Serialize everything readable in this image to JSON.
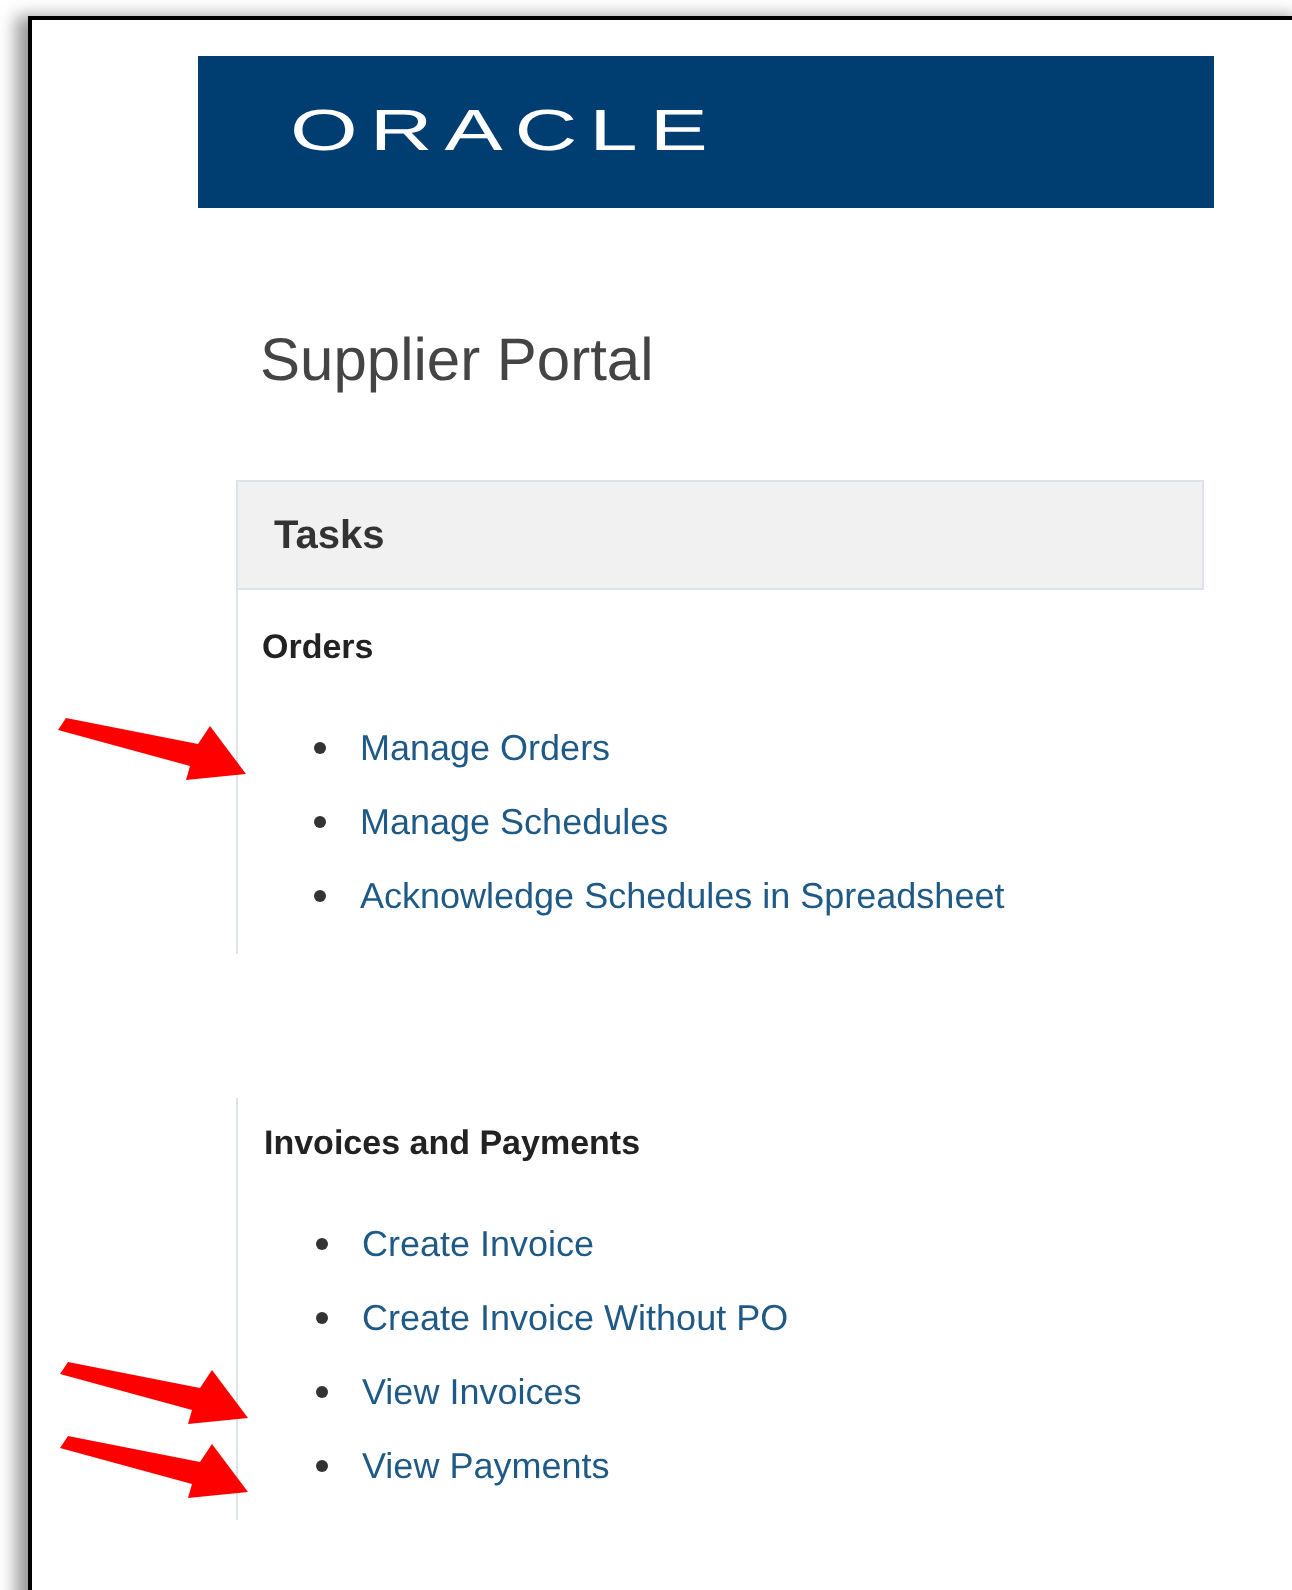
{
  "logo": {
    "text": "ORACLE"
  },
  "page_title": "Supplier Portal",
  "tasks_panel": {
    "title": "Tasks",
    "sections": [
      {
        "heading": "Orders",
        "links": [
          {
            "label": "Manage Orders",
            "pointed": true
          },
          {
            "label": "Manage Schedules",
            "pointed": false
          },
          {
            "label": "Acknowledge Schedules in Spreadsheet",
            "pointed": false
          }
        ]
      },
      {
        "heading": "Invoices and Payments",
        "links": [
          {
            "label": "Create Invoice",
            "pointed": false
          },
          {
            "label": "Create Invoice Without PO",
            "pointed": false
          },
          {
            "label": "View Invoices",
            "pointed": true
          },
          {
            "label": "View Payments",
            "pointed": true
          }
        ]
      }
    ]
  }
}
